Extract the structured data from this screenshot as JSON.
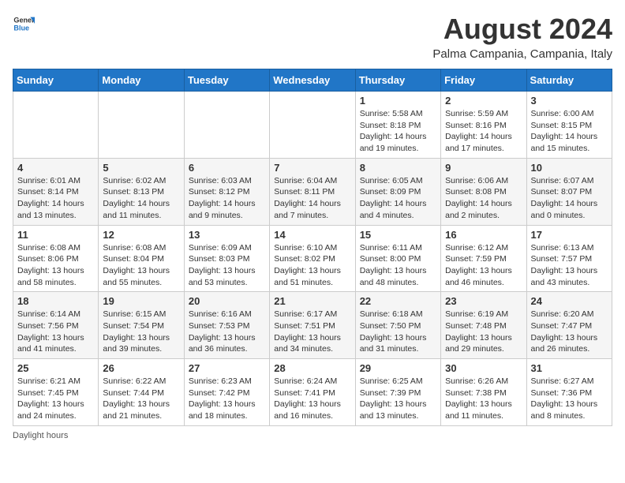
{
  "logo": {
    "text_general": "General",
    "text_blue": "Blue"
  },
  "title": "August 2024",
  "subtitle": "Palma Campania, Campania, Italy",
  "days_of_week": [
    "Sunday",
    "Monday",
    "Tuesday",
    "Wednesday",
    "Thursday",
    "Friday",
    "Saturday"
  ],
  "weeks": [
    [
      {
        "day": "",
        "info": ""
      },
      {
        "day": "",
        "info": ""
      },
      {
        "day": "",
        "info": ""
      },
      {
        "day": "",
        "info": ""
      },
      {
        "day": "1",
        "info": "Sunrise: 5:58 AM\nSunset: 8:18 PM\nDaylight: 14 hours and 19 minutes."
      },
      {
        "day": "2",
        "info": "Sunrise: 5:59 AM\nSunset: 8:16 PM\nDaylight: 14 hours and 17 minutes."
      },
      {
        "day": "3",
        "info": "Sunrise: 6:00 AM\nSunset: 8:15 PM\nDaylight: 14 hours and 15 minutes."
      }
    ],
    [
      {
        "day": "4",
        "info": "Sunrise: 6:01 AM\nSunset: 8:14 PM\nDaylight: 14 hours and 13 minutes."
      },
      {
        "day": "5",
        "info": "Sunrise: 6:02 AM\nSunset: 8:13 PM\nDaylight: 14 hours and 11 minutes."
      },
      {
        "day": "6",
        "info": "Sunrise: 6:03 AM\nSunset: 8:12 PM\nDaylight: 14 hours and 9 minutes."
      },
      {
        "day": "7",
        "info": "Sunrise: 6:04 AM\nSunset: 8:11 PM\nDaylight: 14 hours and 7 minutes."
      },
      {
        "day": "8",
        "info": "Sunrise: 6:05 AM\nSunset: 8:09 PM\nDaylight: 14 hours and 4 minutes."
      },
      {
        "day": "9",
        "info": "Sunrise: 6:06 AM\nSunset: 8:08 PM\nDaylight: 14 hours and 2 minutes."
      },
      {
        "day": "10",
        "info": "Sunrise: 6:07 AM\nSunset: 8:07 PM\nDaylight: 14 hours and 0 minutes."
      }
    ],
    [
      {
        "day": "11",
        "info": "Sunrise: 6:08 AM\nSunset: 8:06 PM\nDaylight: 13 hours and 58 minutes."
      },
      {
        "day": "12",
        "info": "Sunrise: 6:08 AM\nSunset: 8:04 PM\nDaylight: 13 hours and 55 minutes."
      },
      {
        "day": "13",
        "info": "Sunrise: 6:09 AM\nSunset: 8:03 PM\nDaylight: 13 hours and 53 minutes."
      },
      {
        "day": "14",
        "info": "Sunrise: 6:10 AM\nSunset: 8:02 PM\nDaylight: 13 hours and 51 minutes."
      },
      {
        "day": "15",
        "info": "Sunrise: 6:11 AM\nSunset: 8:00 PM\nDaylight: 13 hours and 48 minutes."
      },
      {
        "day": "16",
        "info": "Sunrise: 6:12 AM\nSunset: 7:59 PM\nDaylight: 13 hours and 46 minutes."
      },
      {
        "day": "17",
        "info": "Sunrise: 6:13 AM\nSunset: 7:57 PM\nDaylight: 13 hours and 43 minutes."
      }
    ],
    [
      {
        "day": "18",
        "info": "Sunrise: 6:14 AM\nSunset: 7:56 PM\nDaylight: 13 hours and 41 minutes."
      },
      {
        "day": "19",
        "info": "Sunrise: 6:15 AM\nSunset: 7:54 PM\nDaylight: 13 hours and 39 minutes."
      },
      {
        "day": "20",
        "info": "Sunrise: 6:16 AM\nSunset: 7:53 PM\nDaylight: 13 hours and 36 minutes."
      },
      {
        "day": "21",
        "info": "Sunrise: 6:17 AM\nSunset: 7:51 PM\nDaylight: 13 hours and 34 minutes."
      },
      {
        "day": "22",
        "info": "Sunrise: 6:18 AM\nSunset: 7:50 PM\nDaylight: 13 hours and 31 minutes."
      },
      {
        "day": "23",
        "info": "Sunrise: 6:19 AM\nSunset: 7:48 PM\nDaylight: 13 hours and 29 minutes."
      },
      {
        "day": "24",
        "info": "Sunrise: 6:20 AM\nSunset: 7:47 PM\nDaylight: 13 hours and 26 minutes."
      }
    ],
    [
      {
        "day": "25",
        "info": "Sunrise: 6:21 AM\nSunset: 7:45 PM\nDaylight: 13 hours and 24 minutes."
      },
      {
        "day": "26",
        "info": "Sunrise: 6:22 AM\nSunset: 7:44 PM\nDaylight: 13 hours and 21 minutes."
      },
      {
        "day": "27",
        "info": "Sunrise: 6:23 AM\nSunset: 7:42 PM\nDaylight: 13 hours and 18 minutes."
      },
      {
        "day": "28",
        "info": "Sunrise: 6:24 AM\nSunset: 7:41 PM\nDaylight: 13 hours and 16 minutes."
      },
      {
        "day": "29",
        "info": "Sunrise: 6:25 AM\nSunset: 7:39 PM\nDaylight: 13 hours and 13 minutes."
      },
      {
        "day": "30",
        "info": "Sunrise: 6:26 AM\nSunset: 7:38 PM\nDaylight: 13 hours and 11 minutes."
      },
      {
        "day": "31",
        "info": "Sunrise: 6:27 AM\nSunset: 7:36 PM\nDaylight: 13 hours and 8 minutes."
      }
    ]
  ],
  "footer": "Daylight hours"
}
